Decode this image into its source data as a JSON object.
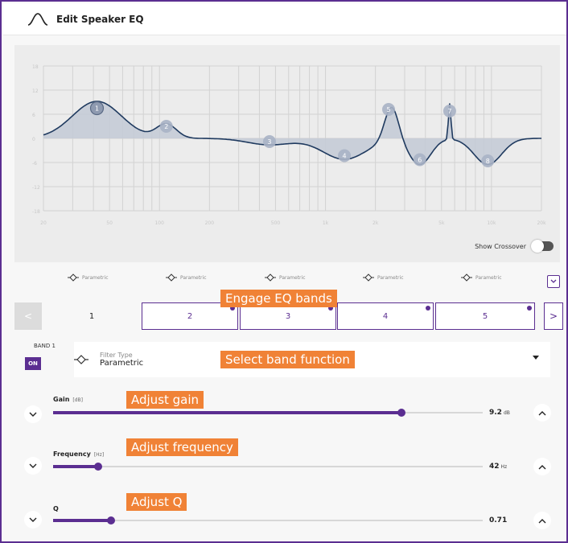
{
  "header": {
    "title": "Edit Speaker EQ"
  },
  "graph": {
    "y_ticks": [
      "18",
      "12",
      "6",
      "0",
      "-6",
      "-12",
      "-18"
    ],
    "x_ticks": [
      "20",
      "50",
      "100",
      "200",
      "500",
      "1k",
      "2k",
      "5k",
      "10k",
      "20k"
    ],
    "band_markers": [
      "1",
      "2",
      "3",
      "4",
      "5",
      "6",
      "7",
      "8"
    ],
    "show_crossover_label": "Show Crossover",
    "show_crossover_on": false
  },
  "filter_types": [
    "Parametric",
    "Parametric",
    "Parametric",
    "Parametric",
    "Parametric"
  ],
  "tabs": {
    "items": [
      {
        "label": "1",
        "active": true
      },
      {
        "label": "2",
        "active": false
      },
      {
        "label": "3",
        "active": false
      },
      {
        "label": "4",
        "active": false
      },
      {
        "label": "5",
        "active": false
      }
    ],
    "prev_glyph": "<",
    "next_glyph": ">"
  },
  "band": {
    "id_label": "BAND 1",
    "on_label": "ON",
    "filter_type_label": "Filter Type",
    "filter_type_value": "Parametric"
  },
  "controls": {
    "gain": {
      "label": "Gain",
      "unit": "[dB]",
      "value": "9.2",
      "value_unit": "dB",
      "fraction": 0.81
    },
    "frequency": {
      "label": "Frequency",
      "unit": "[Hz]",
      "value": "42",
      "value_unit": "Hz",
      "fraction": 0.105
    },
    "q": {
      "label": "Q",
      "unit": "",
      "value": "0.71",
      "value_unit": "",
      "fraction": 0.135
    }
  },
  "callouts": {
    "engage": "Engage EQ bands",
    "select": "Select band function",
    "gain": "Adjust gain",
    "frequency": "Adjust frequency",
    "q": "Adjust Q"
  },
  "colors": {
    "accent": "#5b2e91",
    "callout": "#f08236",
    "curve": "#1f3a5f",
    "fill": "#c3cad6"
  }
}
